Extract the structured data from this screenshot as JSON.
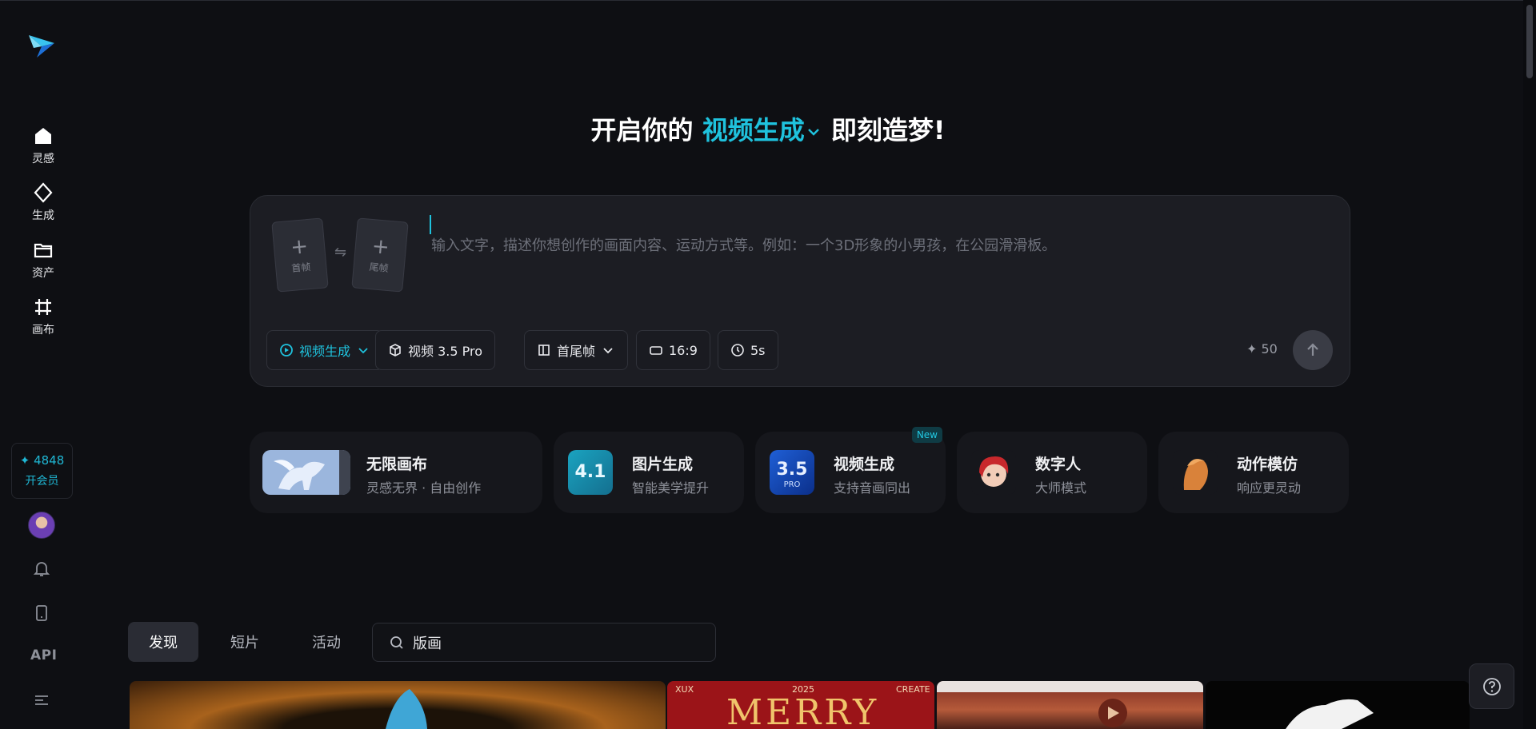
{
  "sidebar": {
    "items": [
      {
        "label": "灵感",
        "icon": "home-icon"
      },
      {
        "label": "生成",
        "icon": "sparkle-icon"
      },
      {
        "label": "资产",
        "icon": "folder-icon"
      },
      {
        "label": "画布",
        "icon": "canvas-icon"
      }
    ],
    "credits": "4848",
    "vip_label": "开会员",
    "api_label": "API"
  },
  "hero": {
    "prefix": "开启你的",
    "mode": "视频生成",
    "suffix": "即刻造梦!"
  },
  "prompt": {
    "placeholder": "输入文字，描述你想创作的画面内容、运动方式等。例如：一个3D形象的小男孩，在公园滑滑板。",
    "first_frame": "首帧",
    "last_frame": "尾帧",
    "chips": {
      "mode": "视频生成",
      "model": "视频 3.5 Pro",
      "frames": "首尾帧",
      "ratio": "16:9",
      "duration": "5s"
    },
    "cost": "50"
  },
  "features": [
    {
      "title": "无限画布",
      "subtitle": "灵感无界 · 自由创作"
    },
    {
      "title": "图片生成",
      "subtitle": "智能美学提升",
      "thumb_text": "4.1"
    },
    {
      "title": "视频生成",
      "subtitle": "支持音画同出",
      "badge": "New",
      "thumb_text": "3.5",
      "thumb_sub": "PRO"
    },
    {
      "title": "数字人",
      "subtitle": "大师模式"
    },
    {
      "title": "动作模仿",
      "subtitle": "响应更灵动"
    }
  ],
  "tabs": [
    "发现",
    "短片",
    "活动"
  ],
  "search": {
    "value": "版画"
  },
  "gallery": {
    "merry_left": "XUX",
    "merry_year": "2025",
    "merry_right": "CREATE",
    "merry_title": "MERRY"
  },
  "colors": {
    "accent": "#1fc2dd",
    "background": "#0e0f13",
    "panel": "#1c1d23"
  }
}
